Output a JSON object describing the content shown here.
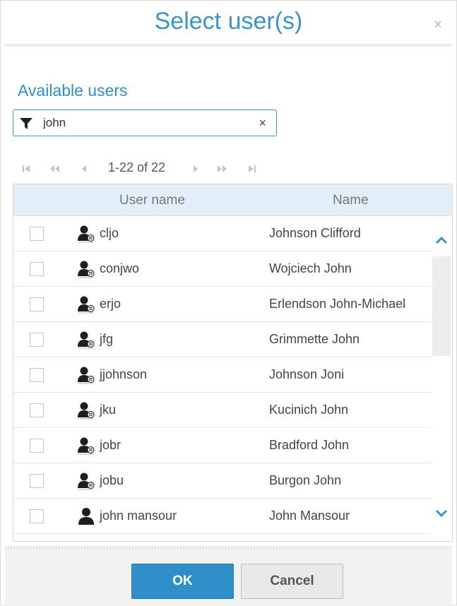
{
  "dialog": {
    "title": "Select user(s)",
    "close_glyph": "×",
    "section_title": "Available users"
  },
  "filter": {
    "icon": "filter-icon",
    "value": "john",
    "clear_glyph": "×"
  },
  "pager": {
    "info": "1-22 of 22"
  },
  "grid": {
    "columns": [
      "User name",
      "Name"
    ],
    "rows": [
      {
        "checked": false,
        "icon": "user-badge-icon",
        "user_name": "cljo",
        "name": "Johnson Clifford"
      },
      {
        "checked": false,
        "icon": "user-badge-icon",
        "user_name": "conjwo",
        "name": "Wojciech John"
      },
      {
        "checked": false,
        "icon": "user-badge-icon",
        "user_name": "erjo",
        "name": "Erlendson John-Michael"
      },
      {
        "checked": false,
        "icon": "user-badge-icon",
        "user_name": "jfg",
        "name": "Grimmette John"
      },
      {
        "checked": false,
        "icon": "user-badge-icon",
        "user_name": "jjohnson",
        "name": "Johnson Joni"
      },
      {
        "checked": false,
        "icon": "user-badge-icon",
        "user_name": "jku",
        "name": "Kucinich John"
      },
      {
        "checked": false,
        "icon": "user-badge-icon",
        "user_name": "jobr",
        "name": "Bradford John"
      },
      {
        "checked": false,
        "icon": "user-badge-icon",
        "user_name": "jobu",
        "name": "Burgon John"
      },
      {
        "checked": false,
        "icon": "user-icon",
        "user_name": "john mansour",
        "name": "John Mansour"
      }
    ]
  },
  "footer": {
    "ok_label": "OK",
    "cancel_label": "Cancel"
  },
  "colors": {
    "accent": "#3a95c4",
    "header_bg": "#e3eff8",
    "ok_bg": "#2e8fca"
  }
}
